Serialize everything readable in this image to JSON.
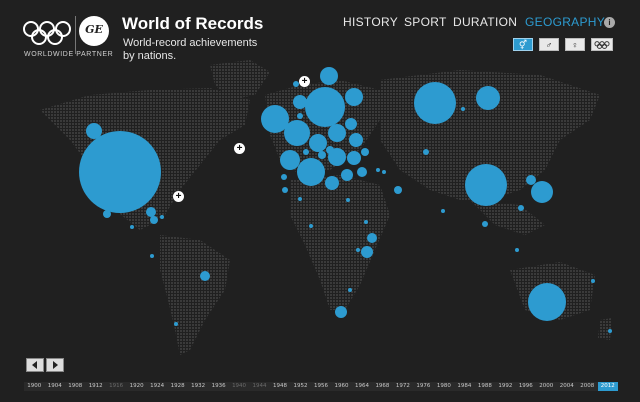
{
  "header": {
    "title": "World of Records",
    "subtitle": "World-record achievements by nations.",
    "partner": "WORLDWIDE PARTNER",
    "ge_logo_text": "GE"
  },
  "nav": [
    {
      "label": "HISTORY",
      "active": false
    },
    {
      "label": "SPORT",
      "active": false
    },
    {
      "label": "DURATION",
      "active": false
    },
    {
      "label": "GEOGRAPHY",
      "active": true
    }
  ],
  "filters": [
    {
      "name": "both-genders",
      "icon": "⚥",
      "active": true
    },
    {
      "name": "male",
      "icon": "♂",
      "active": false
    },
    {
      "name": "female",
      "icon": "♀",
      "active": false
    },
    {
      "name": "olympic",
      "icon": "olympic-rings-icon",
      "active": false
    }
  ],
  "timeline": {
    "years": [
      "1900",
      "1904",
      "1908",
      "1912",
      "1916",
      "1920",
      "1924",
      "1928",
      "1932",
      "1936",
      "1940",
      "1944",
      "1948",
      "1952",
      "1956",
      "1960",
      "1964",
      "1968",
      "1972",
      "1976",
      "1980",
      "1984",
      "1988",
      "1992",
      "1996",
      "2000",
      "2004",
      "2008",
      "2012"
    ],
    "dim_years": [
      "1916",
      "1940",
      "1944"
    ],
    "selected": "2012"
  },
  "colors": {
    "accent": "#2d9bd0",
    "land": "#3a3a3a",
    "ocean": "#202020"
  },
  "expand_markers": [
    "plus-icon",
    "plus-icon",
    "plus-icon"
  ]
}
